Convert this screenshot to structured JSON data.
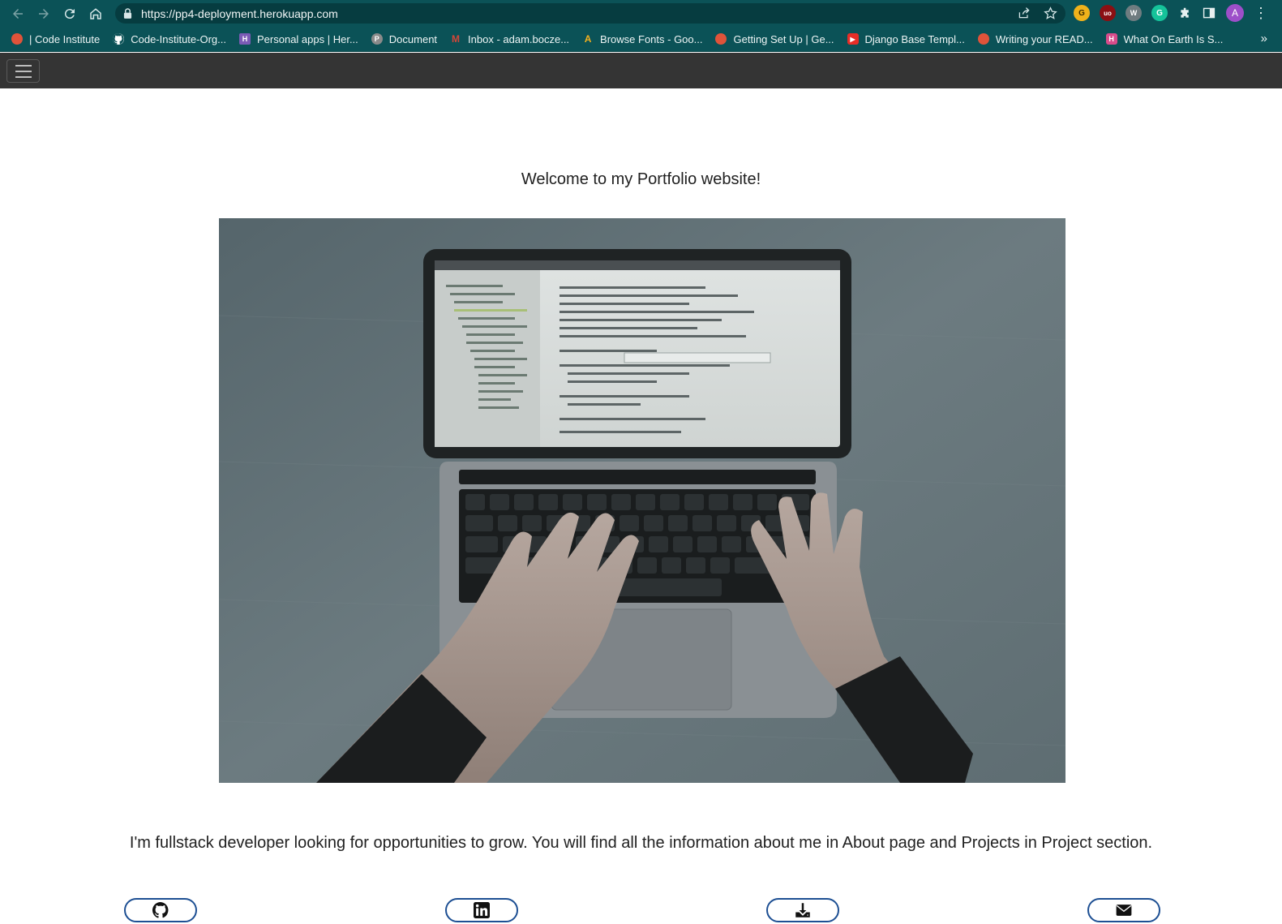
{
  "browser": {
    "url": "https://pp4-deployment.herokuapp.com",
    "profile_initial": "A",
    "bookmarks": [
      {
        "label": "| Code Institute",
        "icon": "code-institute-icon",
        "color": "#e0533a"
      },
      {
        "label": "Code-Institute-Org...",
        "icon": "github-icon",
        "color": "#ffffff"
      },
      {
        "label": "Personal apps | Her...",
        "icon": "heroku-icon",
        "color": "#7b5bb5"
      },
      {
        "label": "Document",
        "icon": "document-icon",
        "color": "#8a8a8a"
      },
      {
        "label": "Inbox - adam.bocze...",
        "icon": "gmail-icon",
        "color": "#d44638"
      },
      {
        "label": "Browse Fonts - Goo...",
        "icon": "google-fonts-icon",
        "color": "#4a7fd8"
      },
      {
        "label": "Getting Set Up | Ge...",
        "icon": "code-institute-icon",
        "color": "#e0533a"
      },
      {
        "label": "Django Base Templ...",
        "icon": "youtube-icon",
        "color": "#e52d27"
      },
      {
        "label": "Writing your READ...",
        "icon": "code-institute-icon",
        "color": "#e0533a"
      },
      {
        "label": "What On Earth Is S...",
        "icon": "hashnode-icon",
        "color": "#d84c8b"
      }
    ]
  },
  "page": {
    "welcome": "Welcome to my Portfolio website!",
    "hero_image_alt": "laptop-typing-photo",
    "intro": "I'm fullstack developer looking for opportunities to grow. You will find all the information about me in About page and Projects in Project section.",
    "social_buttons": [
      {
        "name": "github-button",
        "icon": "github-icon"
      },
      {
        "name": "linkedin-button",
        "icon": "linkedin-icon"
      },
      {
        "name": "download-cv-button",
        "icon": "download-icon"
      },
      {
        "name": "email-button",
        "icon": "envelope-icon"
      }
    ]
  },
  "colors": {
    "browser_chrome": "#0b5257",
    "site_navbar": "#343434",
    "button_border": "#1d4f93"
  }
}
